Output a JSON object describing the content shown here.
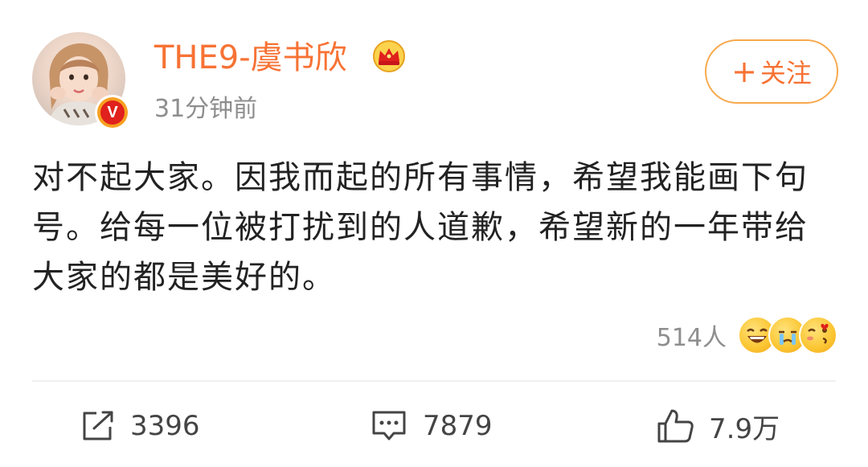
{
  "user": {
    "name": "THE9-虞书欣",
    "timestamp": "31分钟前",
    "verified_badge": "V",
    "follow_label": "关注",
    "follow_icon": "plus-icon"
  },
  "post": {
    "text": "对不起大家。因我而起的所有事情，希望我能画下句号。给每一位被打扰到的人道歉，希望新的一年带给大家的都是美好的。"
  },
  "reactions": {
    "count": "514人",
    "emojis": [
      "laughing-emoji-icon",
      "crying-emoji-icon",
      "kiss-emoji-icon"
    ]
  },
  "actions": {
    "repost": {
      "icon": "repost-icon",
      "count": "3396"
    },
    "comment": {
      "icon": "comment-icon",
      "count": "7879"
    },
    "like": {
      "icon": "thumbs-up-icon",
      "count": "7.9万"
    }
  },
  "colors": {
    "username": "#f77234",
    "follow_border": "#f7a84c",
    "text": "#222222",
    "meta": "#8e8e8e",
    "verified": "#e0211d"
  }
}
